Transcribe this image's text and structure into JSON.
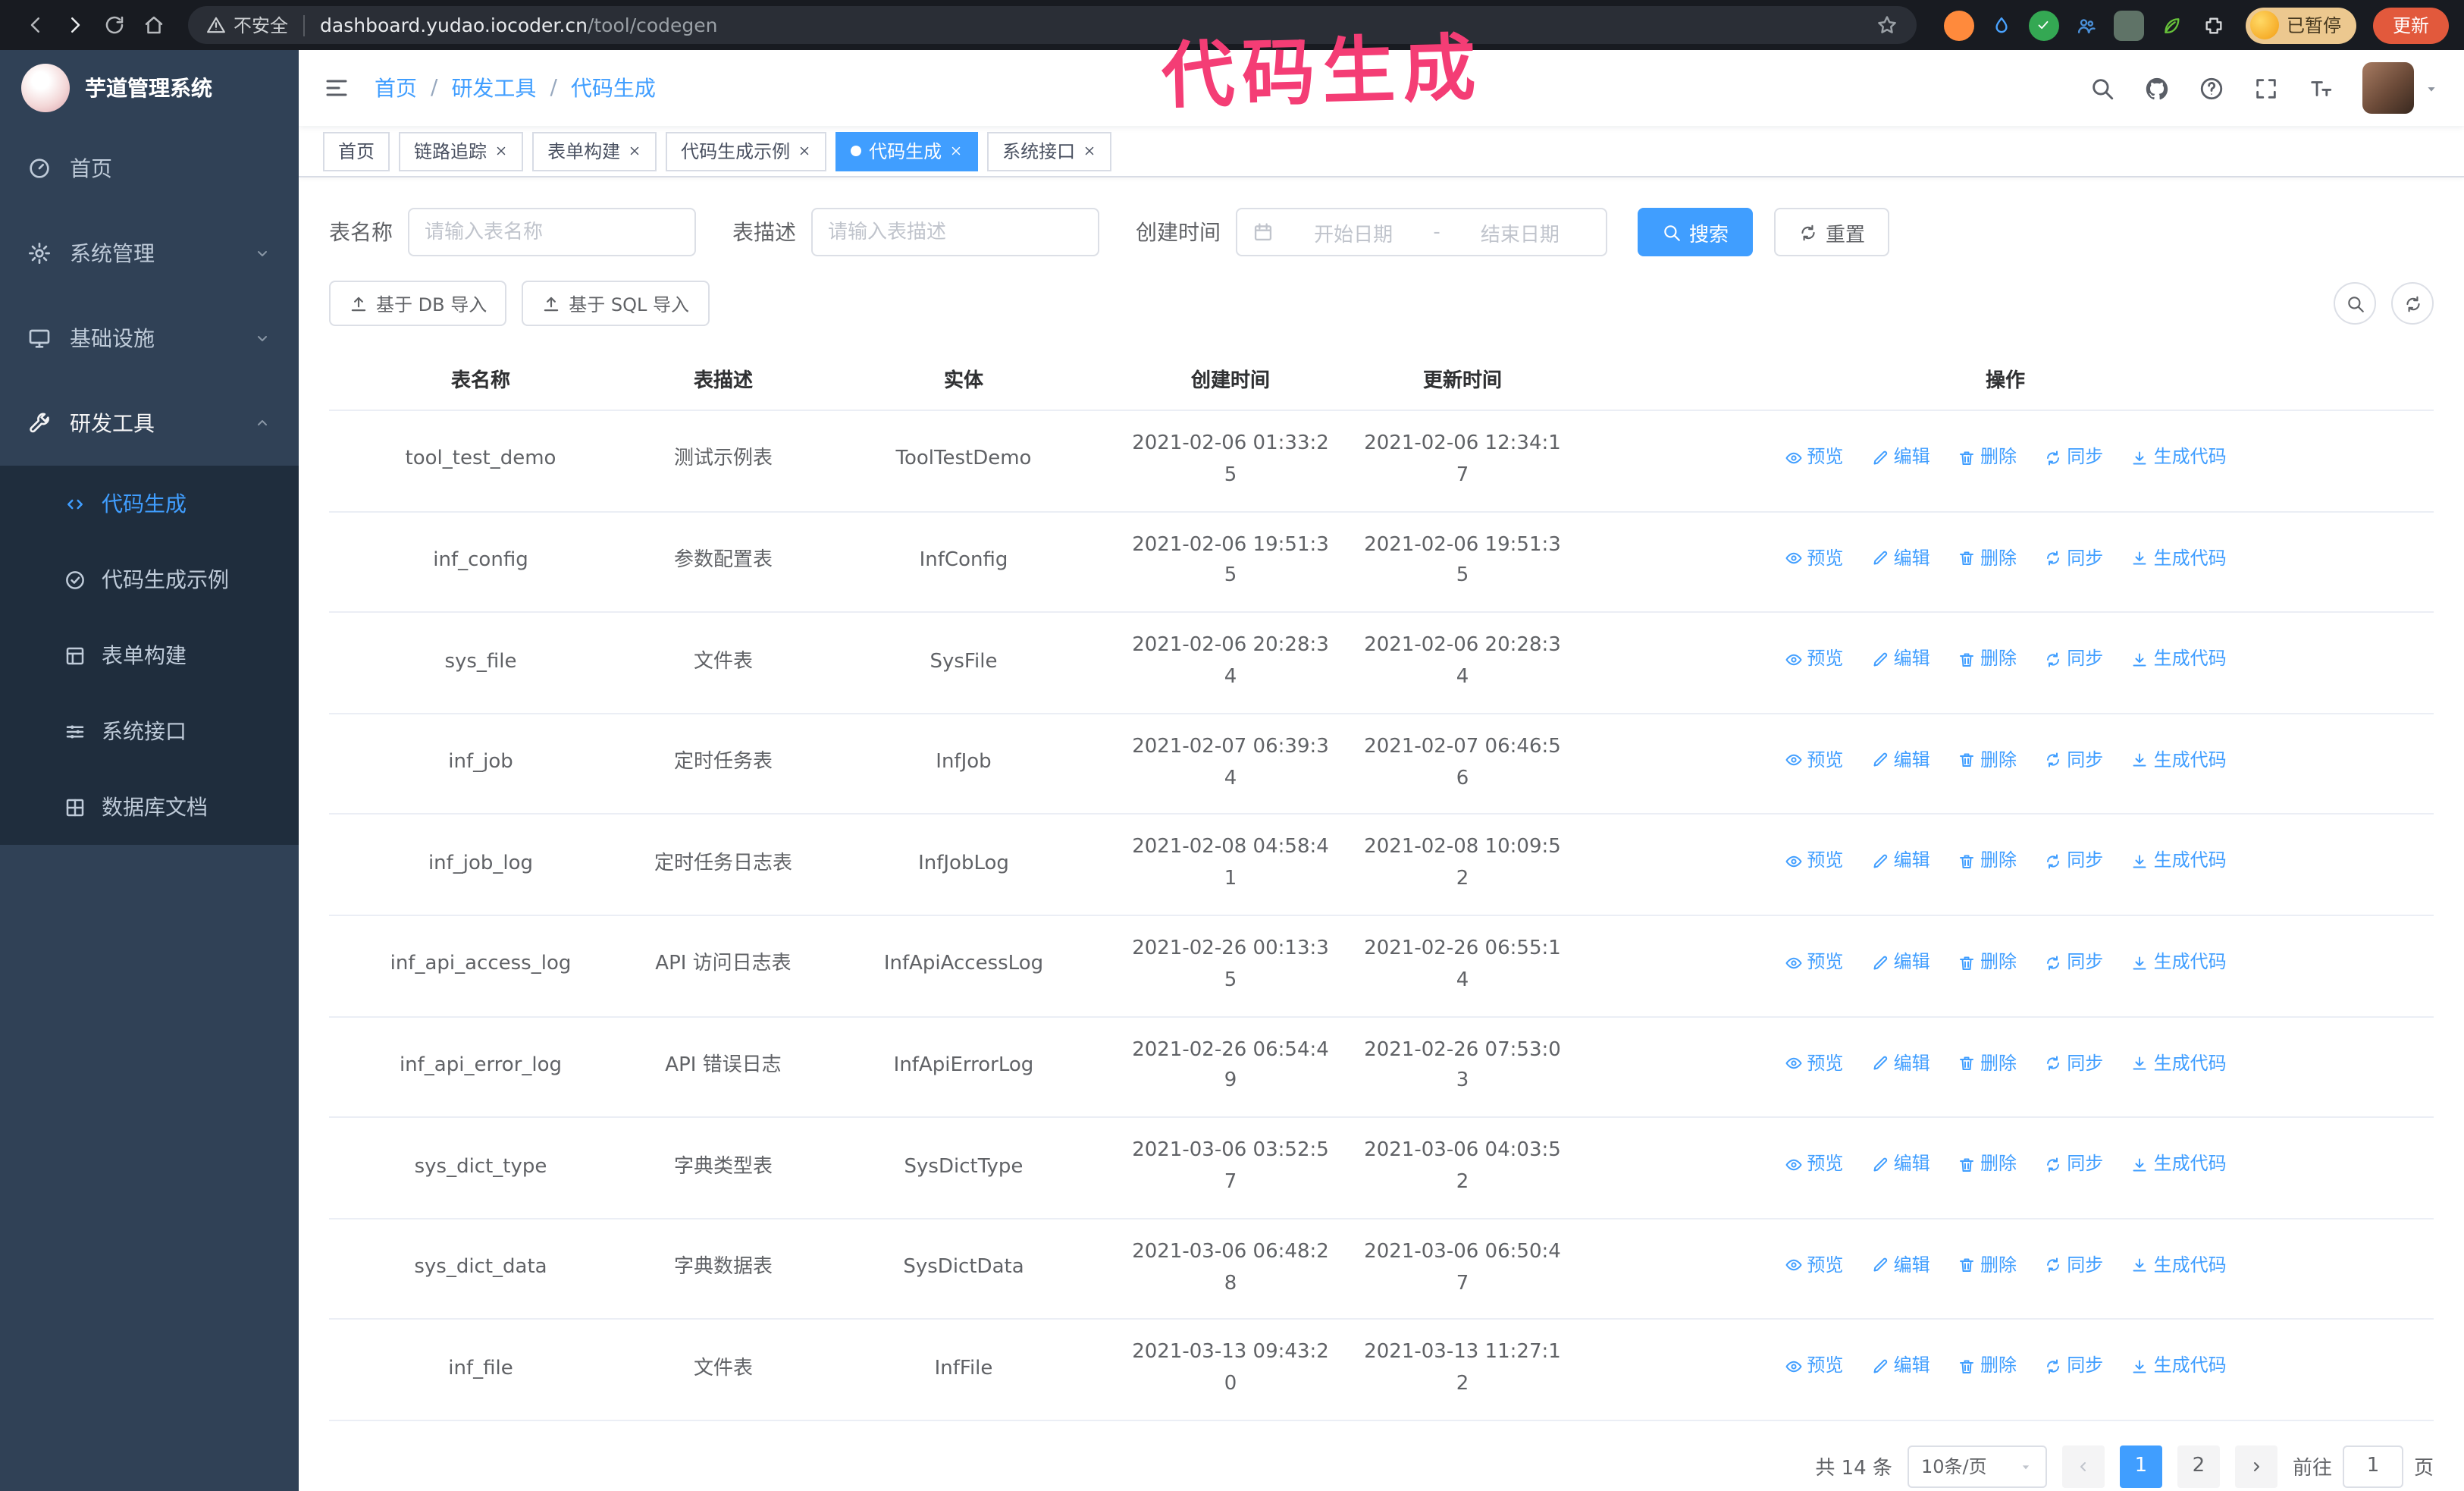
{
  "colors": {
    "primary": "#409eff",
    "sidebar_bg": "#304156",
    "submenu_bg": "#1f2d3d",
    "annotation": "#f43d75",
    "update_button_bg": "#e2593c"
  },
  "browser": {
    "security_label": "不安全",
    "url_host": "dashboard.yudao.iocoder.cn",
    "url_path": "/tool/codegen",
    "profile_badge": "已暂停",
    "update_button": "更新"
  },
  "annotation": {
    "text": "代码生成"
  },
  "sidebar": {
    "logo_title": "芋道管理系统",
    "items": [
      {
        "label": "首页"
      },
      {
        "label": "系统管理"
      },
      {
        "label": "基础设施"
      },
      {
        "label": "研发工具"
      }
    ],
    "submenu": [
      {
        "label": "代码生成"
      },
      {
        "label": "代码生成示例"
      },
      {
        "label": "表单构建"
      },
      {
        "label": "系统接口"
      },
      {
        "label": "数据库文档"
      }
    ]
  },
  "breadcrumb": {
    "items": [
      "首页",
      "研发工具",
      "代码生成"
    ],
    "separator": "/"
  },
  "tabs": [
    {
      "label": "首页"
    },
    {
      "label": "链路追踪"
    },
    {
      "label": "表单构建"
    },
    {
      "label": "代码生成示例"
    },
    {
      "label": "代码生成"
    },
    {
      "label": "系统接口"
    }
  ],
  "filters": {
    "table_name_label": "表名称",
    "table_name_placeholder": "请输入表名称",
    "table_desc_label": "表描述",
    "table_desc_placeholder": "请输入表描述",
    "create_time_label": "创建时间",
    "date_start_placeholder": "开始日期",
    "date_separator": "-",
    "date_end_placeholder": "结束日期",
    "search_button": "搜索",
    "reset_button": "重置"
  },
  "toolbar": {
    "import_db_button": "基于 DB 导入",
    "import_sql_button": "基于 SQL 导入"
  },
  "table": {
    "columns": [
      "表名称",
      "表描述",
      "实体",
      "创建时间",
      "更新时间",
      "操作"
    ],
    "actions": [
      "预览",
      "编辑",
      "删除",
      "同步",
      "生成代码"
    ],
    "rows": [
      {
        "name": "tool_test_demo",
        "desc": "测试示例表",
        "entity": "ToolTestDemo",
        "create_time": "2021-02-06 01:33:25",
        "update_time": "2021-02-06 12:34:17"
      },
      {
        "name": "inf_config",
        "desc": "参数配置表",
        "entity": "InfConfig",
        "create_time": "2021-02-06 19:51:35",
        "update_time": "2021-02-06 19:51:35"
      },
      {
        "name": "sys_file",
        "desc": "文件表",
        "entity": "SysFile",
        "create_time": "2021-02-06 20:28:34",
        "update_time": "2021-02-06 20:28:34"
      },
      {
        "name": "inf_job",
        "desc": "定时任务表",
        "entity": "InfJob",
        "create_time": "2021-02-07 06:39:34",
        "update_time": "2021-02-07 06:46:56"
      },
      {
        "name": "inf_job_log",
        "desc": "定时任务日志表",
        "entity": "InfJobLog",
        "create_time": "2021-02-08 04:58:41",
        "update_time": "2021-02-08 10:09:52"
      },
      {
        "name": "inf_api_access_log",
        "desc": "API 访问日志表",
        "entity": "InfApiAccessLog",
        "create_time": "2021-02-26 00:13:35",
        "update_time": "2021-02-26 06:55:14"
      },
      {
        "name": "inf_api_error_log",
        "desc": "API 错误日志",
        "entity": "InfApiErrorLog",
        "create_time": "2021-02-26 06:54:49",
        "update_time": "2021-02-26 07:53:03"
      },
      {
        "name": "sys_dict_type",
        "desc": "字典类型表",
        "entity": "SysDictType",
        "create_time": "2021-03-06 03:52:57",
        "update_time": "2021-03-06 04:03:52"
      },
      {
        "name": "sys_dict_data",
        "desc": "字典数据表",
        "entity": "SysDictData",
        "create_time": "2021-03-06 06:48:28",
        "update_time": "2021-03-06 06:50:47"
      },
      {
        "name": "inf_file",
        "desc": "文件表",
        "entity": "InfFile",
        "create_time": "2021-03-13 09:43:20",
        "update_time": "2021-03-13 11:27:12"
      }
    ]
  },
  "pagination": {
    "total_text": "共 14 条",
    "page_size": "10条/页",
    "pages": [
      "1",
      "2"
    ],
    "goto_prefix": "前往",
    "goto_value": "1",
    "goto_suffix": "页"
  }
}
